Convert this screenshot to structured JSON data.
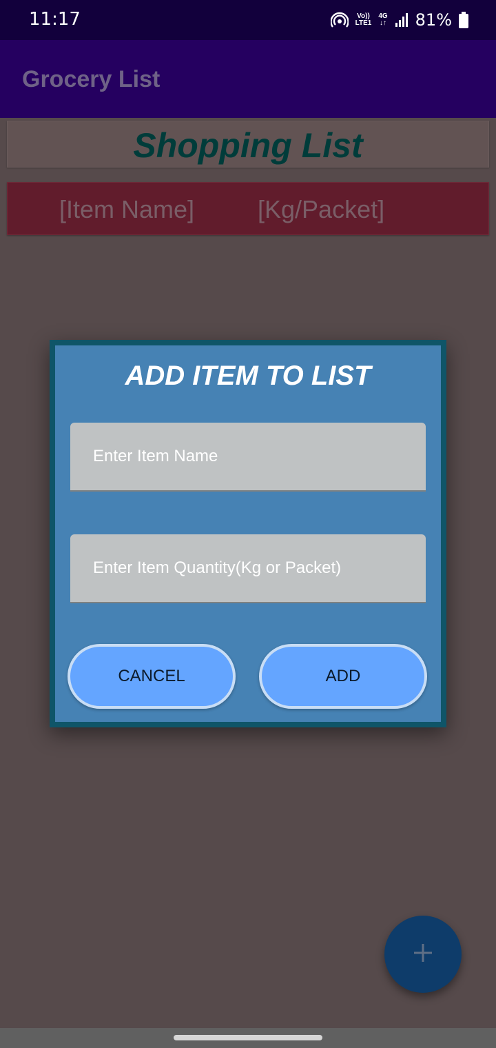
{
  "status_bar": {
    "time": "11:17",
    "network_volte": "Vo))",
    "network_lte": "LTE1",
    "network_gen": "4G",
    "battery": "81%",
    "icons": [
      "hotspot-icon",
      "signal-icon",
      "battery-icon"
    ]
  },
  "app_bar": {
    "title": "Grocery List"
  },
  "list": {
    "title": "Shopping List",
    "columns": [
      "[Item Name]",
      "[Kg/Packet]"
    ]
  },
  "dialog": {
    "title": "ADD ITEM TO LIST",
    "item_name_placeholder": "Enter Item Name",
    "item_quantity_placeholder": "Enter Item Quantity(Kg or Packet)",
    "cancel_label": "CANCEL",
    "add_label": "ADD"
  },
  "fab": {
    "icon": "plus-icon"
  },
  "colors": {
    "status_bar": "#12003c",
    "app_bar": "#250060",
    "dialog_border": "#0f5568",
    "dialog_bg": "#4682b4",
    "button_bg": "#64a5ff",
    "scrim": "#564a4b"
  }
}
